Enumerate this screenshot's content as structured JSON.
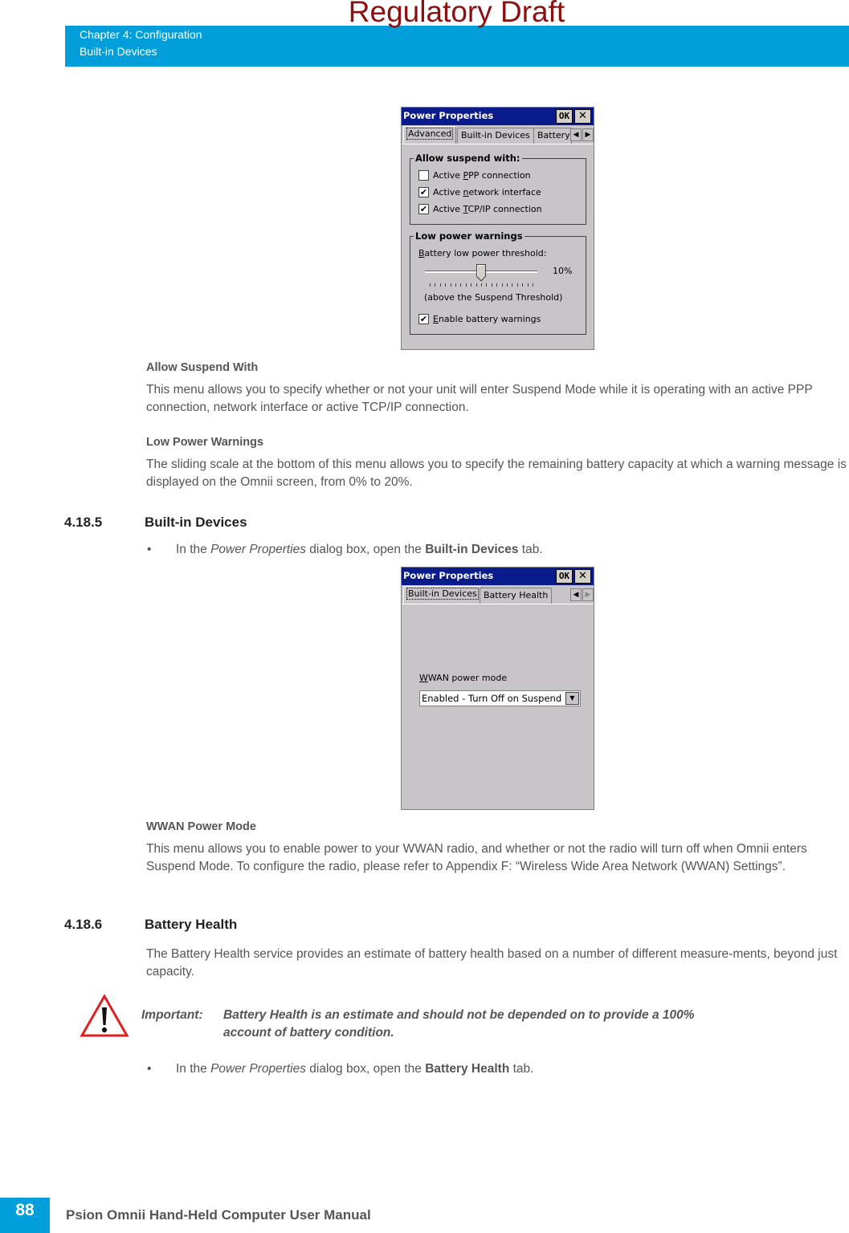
{
  "watermark": "Regulatory Draft",
  "header": {
    "chapter": "Chapter 4:  Configuration",
    "section": "Built-in Devices",
    "accent_color": "#009fdb"
  },
  "dialog1": {
    "title": "Power Properties",
    "ok_label": "OK",
    "close_label": "✕",
    "tabs": [
      "Advanced",
      "Built-in Devices",
      "Battery"
    ],
    "active_tab": "Advanced",
    "scroll_left_icon": "◀",
    "scroll_right_icon": "▶",
    "suspend_group": {
      "legend": "Allow suspend with:",
      "options": [
        {
          "pre": "Active ",
          "accel": "P",
          "post": "PP connection",
          "checked": false
        },
        {
          "pre": "Active ",
          "accel": "n",
          "post": "etwork interface",
          "checked": true
        },
        {
          "pre": "Active ",
          "accel": "T",
          "post": "CP/IP connection",
          "checked": true
        }
      ]
    },
    "warnings_group": {
      "legend": "Low power warnings",
      "threshold_label_accel": "B",
      "threshold_label_rest": "attery low power threshold:",
      "slider_value_text": "10%",
      "slider": {
        "value": 10,
        "min": 0,
        "max": 20,
        "ticks": 21
      },
      "slider_note": "(above the Suspend Threshold)",
      "enable_warnings": {
        "accel": "E",
        "rest": "nable battery warnings",
        "checked": true
      }
    }
  },
  "dialog2": {
    "title": "Power Properties",
    "ok_label": "OK",
    "close_label": "✕",
    "tabs": [
      "Built-in Devices",
      "Battery Health"
    ],
    "active_tab": "Built-in Devices",
    "scroll_left_icon": "◀",
    "scroll_right_icon": "▶",
    "wwan_label_accel": "W",
    "wwan_label_rest": "WAN power mode",
    "wwan_selected": "Enabled - Turn Off on Suspend",
    "dropdown_icon": "▼"
  },
  "body": {
    "allow_suspend_heading": "Allow Suspend With",
    "allow_suspend_text": "This menu allows you to specify whether or not your unit will enter Suspend Mode while it is operating with an active PPP connection, network interface or active TCP/IP connection.",
    "low_power_heading": "Low Power Warnings",
    "low_power_text": "The sliding scale at the bottom of this menu allows you to specify the remaining battery capacity at which a warning message is displayed on the Omnii screen, from 0% to 20%.",
    "sec1_num": "4.18.5",
    "sec1_title": "Built-in Devices",
    "bullet1": {
      "dot": "•",
      "pre": "In the ",
      "ital": "Power Properties",
      "mid": " dialog box, open the ",
      "bold": "Built-in Devices",
      "post": " tab."
    },
    "wwan_heading": "WWAN Power Mode",
    "wwan_text": "This menu allows you to enable power to your WWAN radio, and whether or not the radio will turn off when Omnii enters Suspend Mode. To configure the radio, please refer to Appendix F: “Wireless Wide Area Network (WWAN) Settings”.",
    "sec2_num": "4.18.6",
    "sec2_title": "Battery Health",
    "battery_text": "The Battery Health service provides an estimate of battery health based on a number of different measure-ments, beyond just capacity.",
    "important_label": "Important:",
    "important_line1": "Battery Health is an estimate and should not be depended on to provide a 100%",
    "important_line2": "account of battery condition.",
    "bullet2": {
      "dot": "•",
      "pre": "In the ",
      "ital": "Power Properties",
      "mid": " dialog box, open the ",
      "bold": "Battery Health",
      "post": "  tab."
    }
  },
  "footer": {
    "page_number": "88",
    "manual_title": "Psion Omnii Hand-Held Computer User Manual"
  }
}
